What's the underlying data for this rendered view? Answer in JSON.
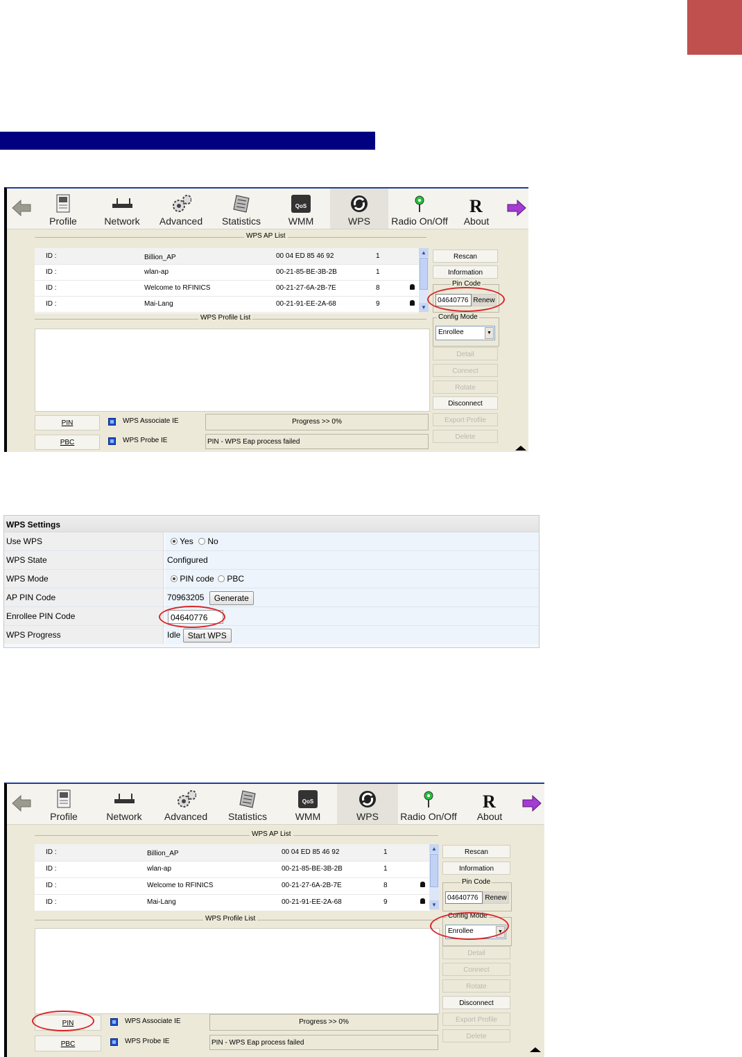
{
  "toolbar": {
    "items": [
      "Profile",
      "Network",
      "Advanced",
      "Statistics",
      "WMM",
      "WPS",
      "Radio On/Off",
      "About"
    ],
    "wmm_badge": "QoS"
  },
  "ap_list": {
    "title": "WPS AP List",
    "rows": [
      {
        "id": "ID :",
        "ssid": "Billion_AP",
        "bssid": "00 04 ED 85 46 92",
        "channel": "1",
        "locked": false
      },
      {
        "id": "ID :",
        "ssid": "wlan-ap",
        "bssid": "00-21-85-BE-3B-2B",
        "channel": "1",
        "locked": false
      },
      {
        "id": "ID :",
        "ssid": "Welcome to RFINICS",
        "bssid": "00-21-27-6A-2B-7E",
        "channel": "8",
        "locked": true
      },
      {
        "id": "ID :",
        "ssid": "Mai-Lang",
        "bssid": "00-21-91-EE-2A-68",
        "channel": "9",
        "locked": true
      }
    ]
  },
  "profile_list": {
    "title": "WPS Profile List"
  },
  "side": {
    "rescan": "Rescan",
    "information": "Information",
    "pin_code_legend": "Pin Code",
    "pin_code_value": "04640776",
    "renew": "Renew",
    "config_mode_legend": "Config Mode",
    "config_mode_value": "Enrollee",
    "detail": "Detail",
    "connect": "Connect",
    "rotate": "Rotate",
    "disconnect": "Disconnect",
    "export_profile": "Export Profile",
    "delete": "Delete"
  },
  "bottom": {
    "pin": "PIN",
    "pbc": "PBC",
    "assoc_ie": "WPS Associate IE",
    "probe_ie": "WPS Probe IE",
    "progress": "Progress >> 0%",
    "status": "PIN - WPS Eap process failed"
  },
  "router": {
    "header": "WPS Settings",
    "use_wps_label": "Use WPS",
    "use_wps_yes": "Yes",
    "use_wps_no": "No",
    "state_label": "WPS State",
    "state_value": "Configured",
    "mode_label": "WPS Mode",
    "mode_pin": "PIN code",
    "mode_pbc": "PBC",
    "ap_pin_label": "AP PIN Code",
    "ap_pin_value": "70963205",
    "generate": "Generate",
    "enrollee_label": "Enrollee PIN Code",
    "enrollee_value": "04640776",
    "progress_label": "WPS Progress",
    "progress_value": "Idle",
    "start_wps": "Start WPS"
  },
  "colors": {
    "accent_tab": "#c0504d",
    "title_bar": "#000080",
    "highlight_ellipse": "#d8242a"
  }
}
